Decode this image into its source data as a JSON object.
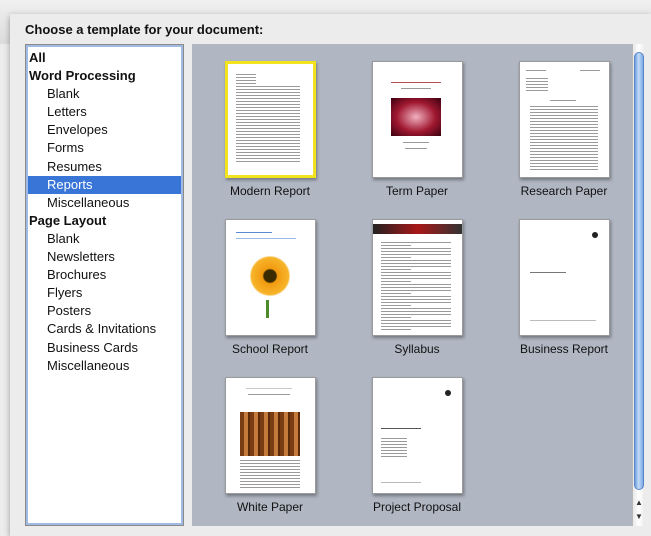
{
  "dialog": {
    "prompt": "Choose a template for your document:"
  },
  "categories": [
    {
      "label": "All",
      "level": 0,
      "selected": false
    },
    {
      "label": "Word Processing",
      "level": 0,
      "selected": false
    },
    {
      "label": "Blank",
      "level": 1,
      "selected": false
    },
    {
      "label": "Letters",
      "level": 1,
      "selected": false
    },
    {
      "label": "Envelopes",
      "level": 1,
      "selected": false
    },
    {
      "label": "Forms",
      "level": 1,
      "selected": false
    },
    {
      "label": "Resumes",
      "level": 1,
      "selected": false
    },
    {
      "label": "Reports",
      "level": 1,
      "selected": true
    },
    {
      "label": "Miscellaneous",
      "level": 1,
      "selected": false
    },
    {
      "label": "Page Layout",
      "level": 0,
      "selected": false
    },
    {
      "label": "Blank",
      "level": 1,
      "selected": false
    },
    {
      "label": "Newsletters",
      "level": 1,
      "selected": false
    },
    {
      "label": "Brochures",
      "level": 1,
      "selected": false
    },
    {
      "label": "Flyers",
      "level": 1,
      "selected": false
    },
    {
      "label": "Posters",
      "level": 1,
      "selected": false
    },
    {
      "label": "Cards & Invitations",
      "level": 1,
      "selected": false
    },
    {
      "label": "Business Cards",
      "level": 1,
      "selected": false
    },
    {
      "label": "Miscellaneous",
      "level": 1,
      "selected": false
    }
  ],
  "templates": [
    {
      "label": "Modern Report",
      "selected": true,
      "preview": "text-doc"
    },
    {
      "label": "Term Paper",
      "selected": false,
      "preview": "red-photo"
    },
    {
      "label": "Research Paper",
      "selected": false,
      "preview": "dense-text"
    },
    {
      "label": "School Report",
      "selected": false,
      "preview": "flower"
    },
    {
      "label": "Syllabus",
      "selected": false,
      "preview": "banner-text"
    },
    {
      "label": "Business Report",
      "selected": false,
      "preview": "business"
    },
    {
      "label": "White Paper",
      "selected": false,
      "preview": "wood-photo"
    },
    {
      "label": "Project Proposal",
      "selected": false,
      "preview": "proposal"
    }
  ],
  "colors": {
    "selection": "#3875d7",
    "template_selection_border": "#f1e31d",
    "grid_background": "#b0b6c2"
  },
  "scrollbar": {
    "up_icon": "arrow-up-icon",
    "down_icon": "arrow-down-icon"
  }
}
